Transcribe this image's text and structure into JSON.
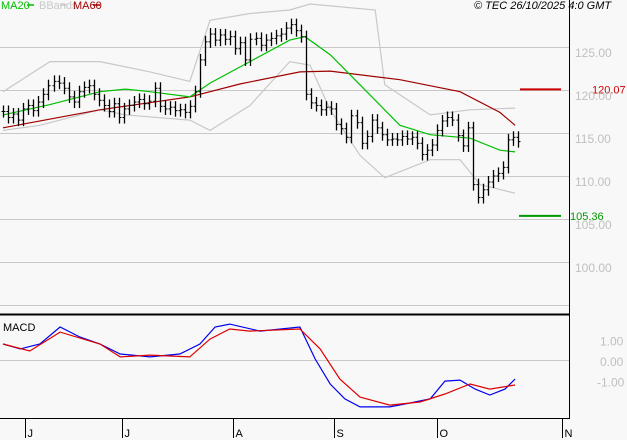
{
  "header": {
    "legend": [
      {
        "label": "MA20",
        "color": "#00c000"
      },
      {
        "label": "BBands",
        "color": "#c8c8c8"
      },
      {
        "label": "MA60",
        "color": "#a00000"
      }
    ],
    "copyright": "© TEC 26/10/2025 4:0 GMT"
  },
  "markers": {
    "resistance": {
      "label": "120.07",
      "value": 120.07,
      "color": "#cc0000"
    },
    "support": {
      "label": "105.36",
      "value": 105.36,
      "color": "#009900"
    }
  },
  "chart_data": [
    {
      "type": "ohlc",
      "title": "Price",
      "y_ticks": [
        {
          "v": 125,
          "label": "125.00"
        },
        {
          "v": 120,
          "label": "120.00"
        },
        {
          "v": 115,
          "label": "115.00"
        },
        {
          "v": 110,
          "label": "110.00"
        },
        {
          "v": 105,
          "label": "105.00"
        },
        {
          "v": 100,
          "label": "100.00"
        }
      ],
      "ylim": [
        94,
        130
      ],
      "x_ticks": [
        {
          "i": 4.4,
          "label": "J"
        },
        {
          "i": 23.6,
          "label": "J"
        },
        {
          "i": 45.5,
          "label": "A"
        },
        {
          "i": 65.5,
          "label": "S"
        },
        {
          "i": 86,
          "label": "O"
        },
        {
          "i": 110.7,
          "label": "N"
        }
      ],
      "closes": [
        117.5,
        116.8,
        117.2,
        116.5,
        117.8,
        118.2,
        117.6,
        118.6,
        119.5,
        120.5,
        121,
        120.8,
        120.2,
        119.2,
        118.6,
        119.8,
        120.3,
        120.5,
        119.5,
        118.8,
        118.2,
        117.5,
        118.4,
        116.8,
        117.8,
        118.2,
        118.6,
        118.9,
        118.4,
        118.7,
        120.2,
        118.1,
        117.8,
        118,
        117.6,
        117.7,
        117.4,
        118.1,
        119.8,
        123.5,
        125.6,
        126.5,
        125.8,
        126.4,
        125.9,
        126.2,
        124.8,
        125.5,
        123.5,
        125.9,
        126,
        125.2,
        125.8,
        126,
        126.3,
        126.5,
        127.2,
        127.6,
        126.9,
        126.2,
        119.5,
        118.5,
        118.2,
        117.7,
        118,
        117.8,
        116,
        115.5,
        114.5,
        117,
        116.2,
        113.8,
        114.6,
        116.5,
        115.6,
        114.8,
        114.2,
        114.3,
        114.2,
        114.6,
        114.3,
        114.5,
        113.8,
        112.5,
        113,
        113.6,
        115.3,
        116.4,
        116.8,
        116.5,
        114.7,
        113.5,
        115.6,
        109,
        107.5,
        108.4,
        109.3,
        110,
        110.3,
        111,
        114.2,
        114.5,
        114
      ],
      "ma20": [
        [
          0,
          117.1
        ],
        [
          9.3,
          118.3
        ],
        [
          19.2,
          119.8
        ],
        [
          24.2,
          120.1
        ],
        [
          29.1,
          119.8
        ],
        [
          37,
          119.2
        ],
        [
          41,
          120.8
        ],
        [
          48.9,
          123.3
        ],
        [
          56.8,
          125.8
        ],
        [
          59.8,
          126.2
        ],
        [
          64.8,
          124.1
        ],
        [
          70.7,
          120.6
        ],
        [
          78.6,
          115.9
        ],
        [
          84.6,
          114.8
        ],
        [
          92.5,
          114.4
        ],
        [
          98.4,
          113
        ],
        [
          101.4,
          112.8
        ]
      ],
      "ma60": [
        [
          0,
          115.6
        ],
        [
          19.2,
          117.7
        ],
        [
          37,
          119.2
        ],
        [
          46.9,
          120.7
        ],
        [
          58.8,
          122.1
        ],
        [
          64.8,
          122.2
        ],
        [
          78.6,
          121.2
        ],
        [
          90.5,
          119.8
        ],
        [
          98.4,
          117.4
        ],
        [
          101.4,
          115.9
        ]
      ],
      "bb_upper": [
        [
          0,
          119.8
        ],
        [
          9.3,
          123.3
        ],
        [
          19.2,
          123.3
        ],
        [
          29.1,
          122.1
        ],
        [
          37,
          121
        ],
        [
          41,
          128.1
        ],
        [
          48.9,
          128.9
        ],
        [
          56.8,
          129.3
        ],
        [
          60.8,
          130
        ],
        [
          73.7,
          129.3
        ],
        [
          75.6,
          120.6
        ],
        [
          84.6,
          117.1
        ],
        [
          92.5,
          117.7
        ],
        [
          101.4,
          117.9
        ]
      ],
      "bb_lower": [
        [
          0,
          115.3
        ],
        [
          7.3,
          115.9
        ],
        [
          19.2,
          117.7
        ],
        [
          24.2,
          117.1
        ],
        [
          37,
          116.5
        ],
        [
          41,
          115.3
        ],
        [
          48.9,
          118.2
        ],
        [
          56.8,
          123.3
        ],
        [
          60.8,
          122.9
        ],
        [
          64.8,
          117.7
        ],
        [
          70.7,
          112.4
        ],
        [
          75.6,
          109.8
        ],
        [
          84.6,
          111.9
        ],
        [
          90.5,
          111.9
        ],
        [
          94.5,
          109
        ],
        [
          101.4,
          108
        ]
      ]
    },
    {
      "type": "line",
      "title": "MACD",
      "y_ticks": [
        {
          "v": 1,
          "label": "1.00"
        },
        {
          "v": 0,
          "label": "0.00"
        },
        {
          "v": -1,
          "label": "-1.00"
        }
      ],
      "ylim": [
        -2.6,
        2.3
      ],
      "series": [
        {
          "name": "MACD",
          "color": "#0000ee",
          "points": [
            [
              0,
              0.83
            ],
            [
              3.4,
              0.59
            ],
            [
              7.3,
              0.83
            ],
            [
              11.3,
              1.66
            ],
            [
              15.2,
              1.17
            ],
            [
              19.2,
              0.83
            ],
            [
              23.2,
              0.34
            ],
            [
              29.1,
              0.2
            ],
            [
              35,
              0.34
            ],
            [
              39,
              0.83
            ],
            [
              42,
              1.66
            ],
            [
              44.9,
              1.8
            ],
            [
              50.9,
              1.46
            ],
            [
              58.8,
              1.66
            ],
            [
              61.8,
              0.1
            ],
            [
              64.8,
              -1.12
            ],
            [
              67.7,
              -1.85
            ],
            [
              70.7,
              -2.24
            ],
            [
              76.6,
              -2.24
            ],
            [
              80.6,
              -2.05
            ],
            [
              84.6,
              -1.85
            ],
            [
              87.5,
              -0.98
            ],
            [
              90.5,
              -0.93
            ],
            [
              93.5,
              -1.37
            ],
            [
              96.4,
              -1.66
            ],
            [
              99.4,
              -1.37
            ],
            [
              101.4,
              -0.88
            ]
          ]
        },
        {
          "name": "Signal",
          "color": "#dd0000",
          "points": [
            [
              0,
              0.83
            ],
            [
              5.3,
              0.49
            ],
            [
              11.3,
              1.41
            ],
            [
              19.2,
              0.83
            ],
            [
              23.2,
              0.2
            ],
            [
              29.1,
              0.29
            ],
            [
              37,
              0.2
            ],
            [
              41,
              1.07
            ],
            [
              44.9,
              1.56
            ],
            [
              48.9,
              1.46
            ],
            [
              58.8,
              1.56
            ],
            [
              62.8,
              0.59
            ],
            [
              66.7,
              -0.88
            ],
            [
              70.7,
              -1.76
            ],
            [
              76.6,
              -2.15
            ],
            [
              82.6,
              -2
            ],
            [
              87.5,
              -1.61
            ],
            [
              92.5,
              -1.12
            ],
            [
              96.4,
              -1.37
            ],
            [
              101.4,
              -1.17
            ]
          ]
        }
      ]
    }
  ]
}
